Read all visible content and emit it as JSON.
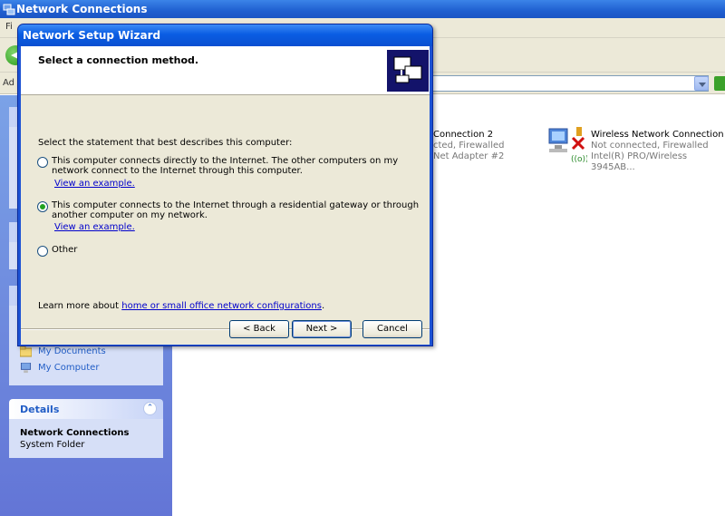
{
  "window": {
    "title": "Network Connections"
  },
  "menu": {
    "partial_label": "Fi"
  },
  "address": {
    "label_partial": "Ad"
  },
  "connections": [
    {
      "name": "Connection 2",
      "status": "cted, Firewalled",
      "device": "Net Adapter #2"
    },
    {
      "name": "Wireless Network Connection",
      "status": "Not connected, Firewalled",
      "device": "Intel(R) PRO/Wireless 3945AB..."
    }
  ],
  "other_places": [
    {
      "label": "My Documents",
      "icon": "folder-icon"
    },
    {
      "label": "My Computer",
      "icon": "computer-icon"
    }
  ],
  "details": {
    "header": "Details",
    "name": "Network Connections",
    "type": "System Folder"
  },
  "dialog": {
    "title": "Network Setup Wizard",
    "heading": "Select a connection method.",
    "prompt": "Select the statement that best describes this computer:",
    "options": [
      {
        "text": "This computer connects directly to the Internet. The other computers on my network connect to the Internet through this computer.",
        "link": "View an example.",
        "selected": false
      },
      {
        "text": "This computer connects to the Internet through a residential gateway or through another computer on my network.",
        "link": "View an example.",
        "selected": true
      },
      {
        "text": "Other",
        "link": "",
        "selected": false
      }
    ],
    "learn_more_prefix": "Learn more about ",
    "learn_more_link": "home or small office network configurations",
    "learn_more_suffix": ".",
    "buttons": {
      "back": "< Back",
      "next": "Next >",
      "cancel": "Cancel"
    }
  },
  "colors": {
    "xp_blue": "#1c52d4",
    "dialog_bg": "#ece9d8",
    "link": "#0000cc",
    "radio_selected": "#21a121"
  }
}
